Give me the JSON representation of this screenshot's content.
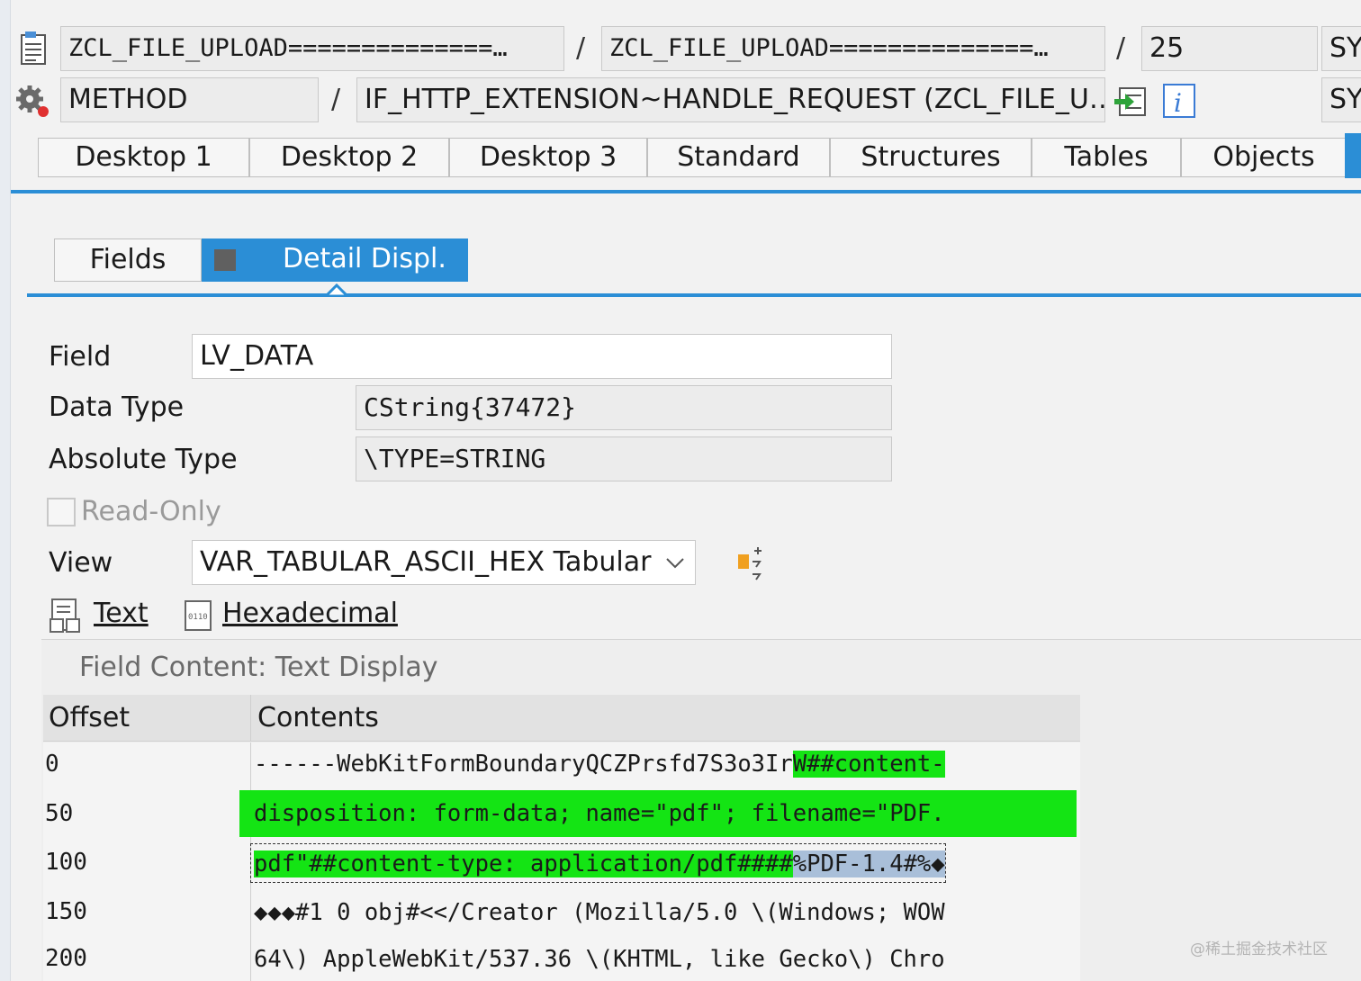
{
  "header": {
    "program": "ZCL_FILE_UPLOAD==============…",
    "include": "ZCL_FILE_UPLOAD==============…",
    "line": "25",
    "sy_top": "SY",
    "event_type": "METHOD",
    "event": "IF_HTTP_EXTENSION~HANDLE_REQUEST (ZCL_FILE_U…",
    "sy_bottom": "SY",
    "separator": "/"
  },
  "tabs": [
    "Desktop 1",
    "Desktop 2",
    "Desktop 3",
    "Standard",
    "Structures",
    "Tables",
    "Objects"
  ],
  "subtabs": {
    "fields": "Fields",
    "detail": "Detail Displ."
  },
  "detail": {
    "field_label": "Field",
    "field_value": "LV_DATA",
    "data_type_label": "Data Type",
    "data_type_value": "CString{37472}",
    "absolute_type_label": "Absolute Type",
    "absolute_type_value": "\\TYPE=STRING",
    "readonly_label": "Read-Only",
    "view_label": "View",
    "view_value": "VAR_TABULAR_ASCII_HEX Tabular",
    "text_link": "Text",
    "hex_link": "Hexadecimal"
  },
  "content": {
    "title": "Field Content: Text Display",
    "col_offset": "Offset",
    "col_contents": "Contents",
    "rows": [
      {
        "offset": "0",
        "plain": "------WebKitFormBoundaryQCZPrsfd7S3o3Ir",
        "hl": "W##content-"
      },
      {
        "offset": "50",
        "hl": "disposition: form-data; name=\"pdf\"; filename=\"PDF."
      },
      {
        "offset": "100",
        "hl": "pdf\"##content-type: application/pdf####",
        "sel": "%PDF-1.4#%◆"
      },
      {
        "offset": "150",
        "plain": "◆◆◆#1 0 obj#<</Creator (Mozilla/5.0 \\(Windows; WOW"
      },
      {
        "offset": "200",
        "plain": "64\\) AppleWebKit/537.36 \\(KHTML, like Gecko\\) Chro"
      }
    ]
  },
  "watermark": "@稀土掘金技术社区",
  "colors": {
    "accent": "#2b8ed6",
    "highlight": "#14e414",
    "selection": "#a9bfd9"
  }
}
